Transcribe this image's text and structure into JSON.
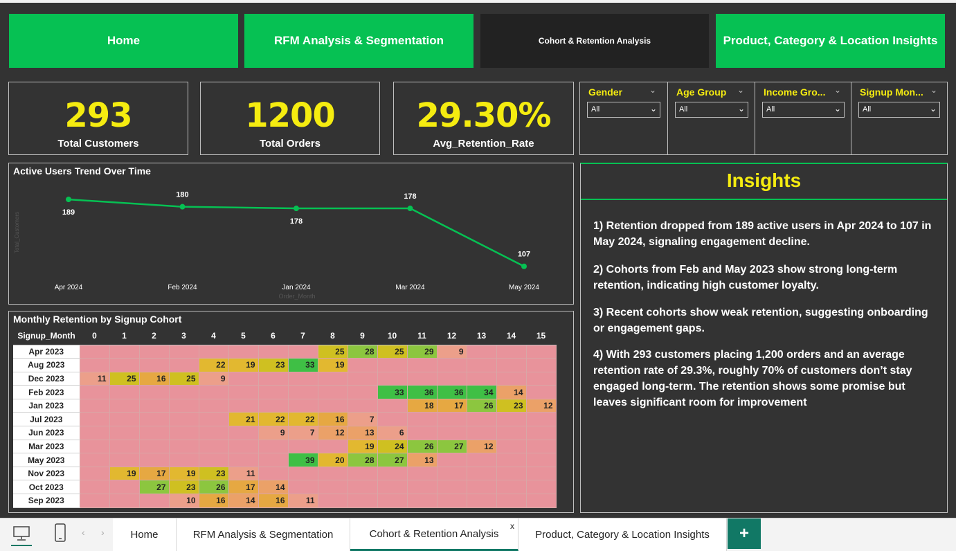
{
  "nav": {
    "home": "Home",
    "rfm": "RFM Analysis & Segmentation",
    "cohort": "Cohort & Retention Analysis",
    "product": "Product, Category & Location Insights"
  },
  "kpis": [
    {
      "value": "293",
      "label": "Total Customers"
    },
    {
      "value": "1200",
      "label": "Total Orders"
    },
    {
      "value": "29.30%",
      "label": "Avg_Retention_Rate"
    }
  ],
  "slicers": [
    {
      "title": "Gender",
      "value": "All"
    },
    {
      "title": "Age Group",
      "value": "All"
    },
    {
      "title": "Income Gro...",
      "value": "All"
    },
    {
      "title": "Signup Mon...",
      "value": "All"
    }
  ],
  "colors": {
    "accent_green": "#06c153",
    "kpi_yellow": "#f5ec10",
    "background": "#333333",
    "tab_accent": "#117865"
  },
  "line_chart": {
    "title": "Active Users Trend Over Time",
    "xlabel": "Order_Month",
    "ylabel": "Total_Customers"
  },
  "chart_data": {
    "type": "line",
    "x": [
      "Apr 2024",
      "Feb 2024",
      "Jan 2024",
      "Mar 2024",
      "May 2024"
    ],
    "series": [
      {
        "values": [
          189,
          180,
          178,
          178,
          107
        ]
      }
    ],
    "title": "Active Users Trend Over Time",
    "xlabel": "Order_Month",
    "ylabel": "Total_Customers",
    "ylim": [
      100,
      195
    ]
  },
  "heatmap": {
    "title": "Monthly Retention by Signup Cohort",
    "row_header": "Signup_Month",
    "columns": [
      "0",
      "1",
      "2",
      "3",
      "4",
      "5",
      "6",
      "7",
      "8",
      "9",
      "10",
      "11",
      "12",
      "13",
      "14",
      "15"
    ],
    "rows": [
      {
        "label": "Apr 2023",
        "cells": [
          "",
          "",
          "",
          "",
          "",
          "",
          "",
          "",
          "25",
          "28",
          "25",
          "29",
          "9",
          "",
          "",
          ""
        ]
      },
      {
        "label": "Aug 2023",
        "cells": [
          "",
          "",
          "",
          "",
          "22",
          "19",
          "23",
          "33",
          "19",
          "",
          "",
          "",
          "",
          "",
          "",
          ""
        ]
      },
      {
        "label": "Dec 2023",
        "cells": [
          "11",
          "25",
          "16",
          "25",
          "9",
          "",
          "",
          "",
          "",
          "",
          "",
          "",
          "",
          "",
          "",
          ""
        ]
      },
      {
        "label": "Feb 2023",
        "cells": [
          "",
          "",
          "",
          "",
          "",
          "",
          "",
          "",
          "",
          "",
          "33",
          "36",
          "36",
          "34",
          "14",
          ""
        ]
      },
      {
        "label": "Jan 2023",
        "cells": [
          "",
          "",
          "",
          "",
          "",
          "",
          "",
          "",
          "",
          "",
          "",
          "18",
          "17",
          "26",
          "23",
          "12"
        ]
      },
      {
        "label": "Jul 2023",
        "cells": [
          "",
          "",
          "",
          "",
          "",
          "21",
          "22",
          "22",
          "16",
          "7",
          "",
          "",
          "",
          "",
          "",
          ""
        ]
      },
      {
        "label": "Jun 2023",
        "cells": [
          "",
          "",
          "",
          "",
          "",
          "",
          "9",
          "7",
          "12",
          "13",
          "6",
          "",
          "",
          "",
          "",
          ""
        ]
      },
      {
        "label": "Mar 2023",
        "cells": [
          "",
          "",
          "",
          "",
          "",
          "",
          "",
          "",
          "",
          "19",
          "24",
          "26",
          "27",
          "12",
          "",
          ""
        ]
      },
      {
        "label": "May 2023",
        "cells": [
          "",
          "",
          "",
          "",
          "",
          "",
          "",
          "39",
          "20",
          "28",
          "27",
          "13",
          "",
          "",
          "",
          ""
        ]
      },
      {
        "label": "Nov 2023",
        "cells": [
          "",
          "19",
          "17",
          "19",
          "23",
          "11",
          "",
          "",
          "",
          "",
          "",
          "",
          "",
          "",
          "",
          ""
        ]
      },
      {
        "label": "Oct 2023",
        "cells": [
          "",
          "",
          "27",
          "23",
          "26",
          "17",
          "14",
          "",
          "",
          "",
          "",
          "",
          "",
          "",
          "",
          ""
        ]
      },
      {
        "label": "Sep 2023",
        "cells": [
          "",
          "",
          "",
          "10",
          "16",
          "14",
          "16",
          "11",
          "",
          "",
          "",
          "",
          "",
          "",
          "",
          ""
        ]
      }
    ]
  },
  "insights": {
    "title": "Insights",
    "points": [
      "1) Retention dropped from 189 active users in Apr 2024 to 107 in May 2024, signaling engagement decline.",
      "2) Cohorts from Feb and May 2023 show strong long-term retention, indicating high customer loyalty.",
      "3) Recent cohorts show weak retention, suggesting onboarding or engagement gaps.",
      "4) With 293 customers placing 1,200 orders and an average retention rate of 29.3%, roughly 70% of customers don’t stay engaged long-term. The retention shows some promise but leaves significant room for improvement"
    ]
  },
  "tabs": {
    "home": "Home",
    "rfm": "RFM Analysis & Segmentation",
    "cohort": "Cohort & Retention Analysis",
    "cohort_close": "x",
    "product": "Product, Category & Location Insights",
    "add": "+"
  },
  "icons": {
    "desktop": "desktop-icon",
    "mobile": "mobile-icon",
    "prev": "chevron-left-icon",
    "next": "chevron-right-icon"
  }
}
